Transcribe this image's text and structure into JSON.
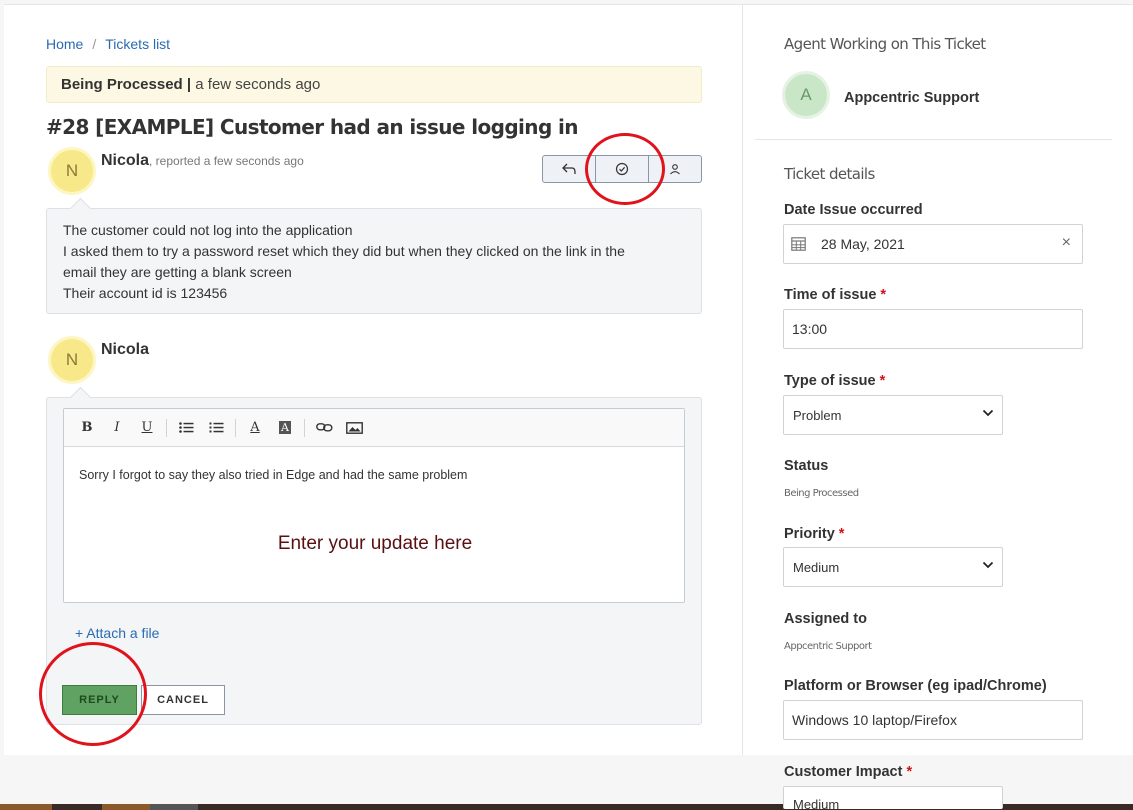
{
  "breadcrumb": {
    "home": "Home",
    "separator": "/",
    "tickets_list": "Tickets list"
  },
  "status": {
    "label": "Being Processed",
    "divider": "|",
    "time": "a few seconds ago",
    "bg_color": "#fcf8e3"
  },
  "ticket": {
    "title": "#28 [EXAMPLE] Customer had an issue logging in"
  },
  "message": {
    "avatar_initial": "N",
    "author": "Nicola",
    "meta": ", reported a few seconds ago",
    "lines": [
      "The customer could not log into the application",
      "I asked them to try a password reset which they did but when they clicked on the link in the",
      "email they are getting a blank screen",
      "Their account id is 123456"
    ]
  },
  "actions": {
    "reply_icon": "reply-arrow-icon",
    "resolve_icon": "check-circle-icon",
    "assign_icon": "user-icon"
  },
  "reply": {
    "avatar_initial": "N",
    "author": "Nicola",
    "editor_text": "Sorry I forgot to say they also tried in Edge and had the same problem",
    "annotation": "Enter your update here",
    "attach_label": "+ Attach a file",
    "reply_button": "REPLY",
    "cancel_button": "CANCEL",
    "toolbar": {
      "bold": "B",
      "italic": "I",
      "underline": "U",
      "font_color": "A",
      "bg_color": "A"
    }
  },
  "sidebar": {
    "agent_heading": "Agent Working on This Ticket",
    "agent_initial": "A",
    "agent_name": "Appcentric Support",
    "details_heading": "Ticket details",
    "date_label": "Date Issue occurred",
    "date_value": "28 May, 2021",
    "clear_symbol": "×",
    "time_label": "Time of issue",
    "time_value": "13:00",
    "type_label": "Type of issue",
    "type_value": "Problem",
    "status_label": "Status",
    "status_value": "Being Processed",
    "priority_label": "Priority",
    "priority_value": "Medium",
    "assigned_label": "Assigned to",
    "assigned_value": "Appcentric Support",
    "platform_label": "Platform or Browser (eg ipad/Chrome)",
    "platform_value": "Windows 10 laptop/Firefox",
    "impact_label": "Customer Impact",
    "impact_value": "Medium",
    "required_mark": "*"
  },
  "colors": {
    "accent_red": "#e0121b",
    "reply_green": "#5fa261",
    "link_blue": "#2a6ab3"
  }
}
